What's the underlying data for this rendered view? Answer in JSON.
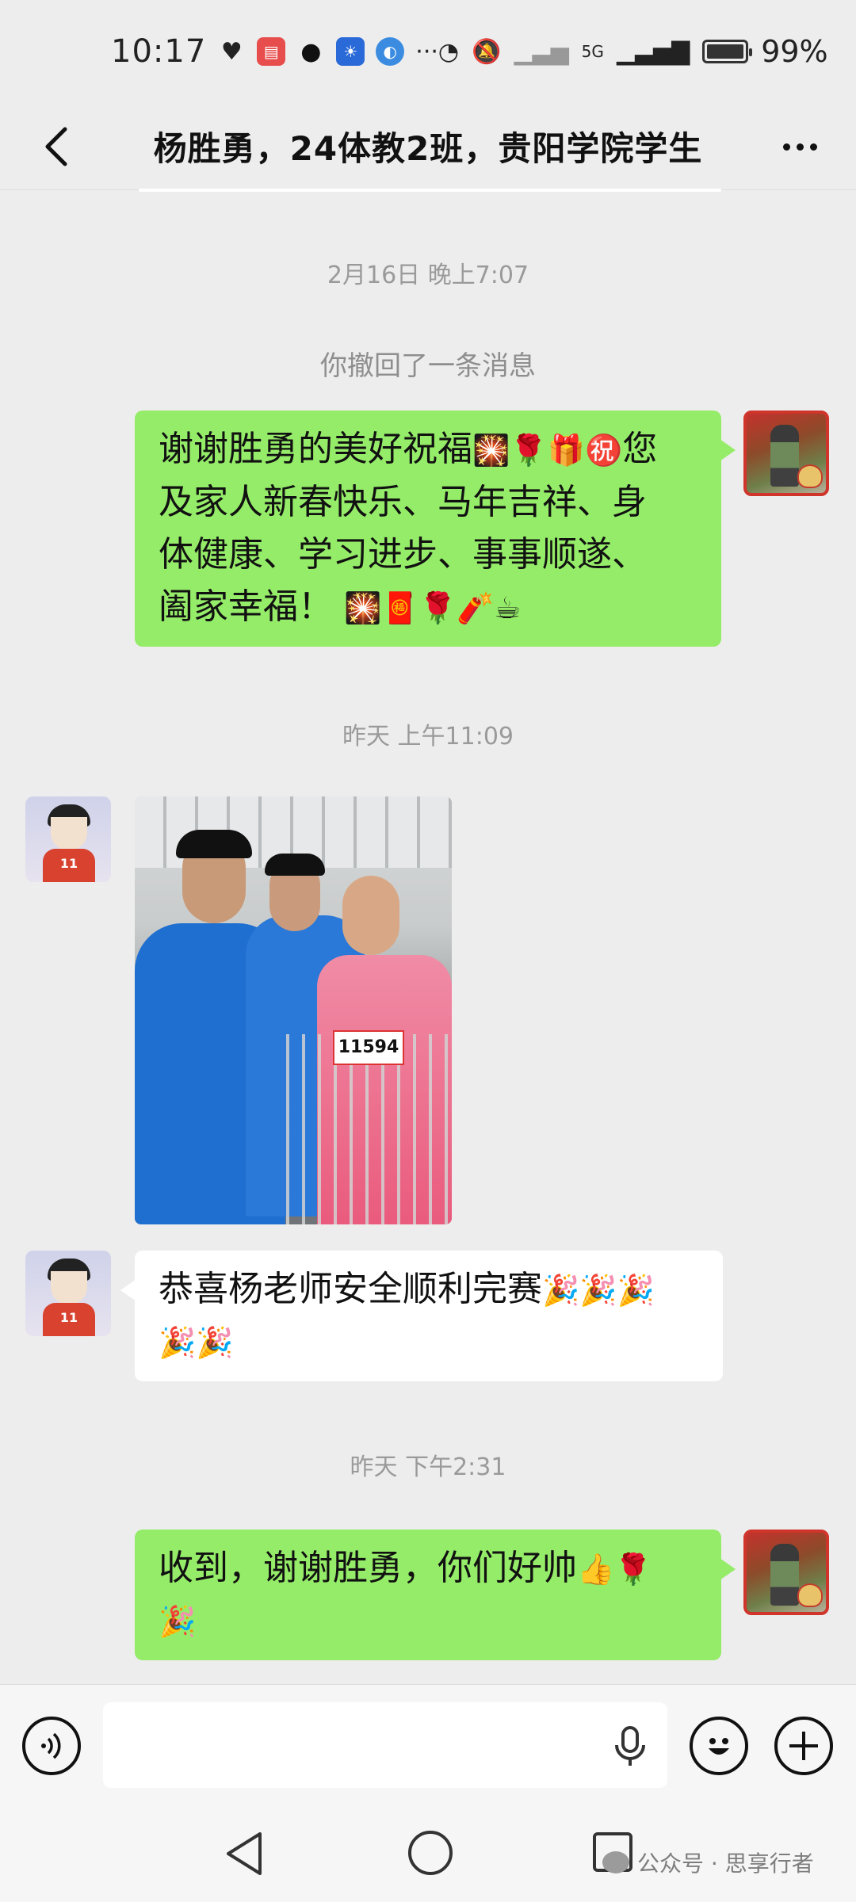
{
  "status_bar": {
    "time": "10:17",
    "app_icons": [
      "heart-rate-icon",
      "huawei-appgallery-icon",
      "qq-icon",
      "bulb-icon",
      "browser-icon"
    ],
    "more": "···",
    "network": "5G",
    "battery_percent": "99%",
    "battery_level": 0.99
  },
  "header": {
    "title": "杨胜勇，24体教2班，贵阳学院学生"
  },
  "messages": [
    {
      "type": "timestamp",
      "text": "2月16日 晚上7:07"
    },
    {
      "type": "system",
      "text": "你撤回了一条消息"
    },
    {
      "type": "text",
      "from": "me",
      "lines": [
        "谢谢胜勇的美好祝福",
        "及家人新春快乐、马年吉祥、身",
        "体健康、学习进步、事事顺遂、",
        "阖家幸福！"
      ],
      "line1_suffix": "您",
      "line1_emojis": "🎇🌹🎁㊗️",
      "line4_emojis": "🎇🧧🌹🧨☕"
    },
    {
      "type": "timestamp",
      "text": "昨天 上午11:09"
    },
    {
      "type": "image",
      "from": "other",
      "bib_number": "11594"
    },
    {
      "type": "text",
      "from": "other",
      "lines": [
        "恭喜杨老师安全顺利完赛"
      ],
      "line1_emojis": "🎉🎉🎉",
      "line2_emojis": "🎉🎉"
    },
    {
      "type": "timestamp",
      "text": "昨天 下午2:31"
    },
    {
      "type": "text",
      "from": "me",
      "lines": [
        "收到，谢谢胜勇，你们好帅"
      ],
      "line1_emojis": "👍🌹",
      "line2_emojis": "🎉"
    }
  ],
  "avatar_other": {
    "jersey_number": "11"
  },
  "input_bar": {
    "placeholder": "",
    "voice_icon": "voice-icon",
    "emoji_icon": "emoji-icon",
    "plus_icon": "plus-icon"
  },
  "watermark": {
    "text": "公众号 · 思享行者"
  },
  "colors": {
    "background": "#ededed",
    "my_bubble": "#95ec69",
    "other_bubble": "#ffffff",
    "timestamp_text": "#9a9a9a"
  }
}
